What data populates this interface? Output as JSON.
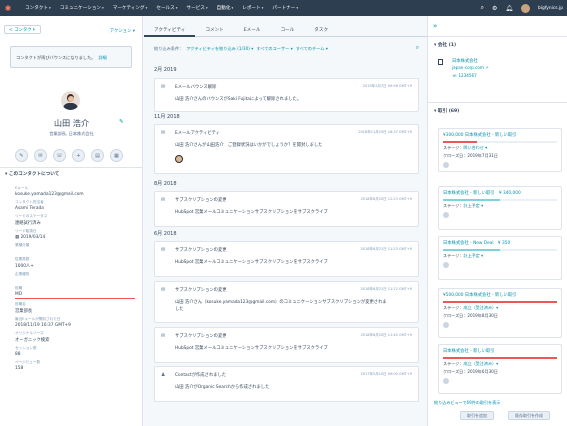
{
  "topnav": {
    "items": [
      "コンタクト",
      "コミュニケーション",
      "マーケティング",
      "セールス",
      "サービス",
      "自動化",
      "レポート",
      "パートナー"
    ],
    "account": "bigfynics.jp"
  },
  "left": {
    "back_button": "< コンタクト",
    "action_link": "アクション ▾",
    "bounce_notice": "コンタクトが再びバウンスになりました。",
    "bounce_link": "詳細",
    "name": "山田 浩介",
    "subtitle": "営業部長, 日本株式会社",
    "section_title": "このコンタクトについて",
    "properties": [
      {
        "label": "Eメール",
        "value": "kosuke.yamada123@gmail.com"
      },
      {
        "label": "コンタクト担当者",
        "value": "Asami Terada"
      },
      {
        "label": "リードのステータス",
        "value": "連絡試行済み"
      },
      {
        "label": "リード転換日",
        "value": "2019/03/14"
      },
      {
        "label": "業種分類",
        "value": ""
      },
      {
        "label": "従業員数",
        "value": "1000人+"
      },
      {
        "label": "企業種別",
        "value": ""
      },
      {
        "label": "役職",
        "value": "MD"
      },
      {
        "label": "役職名",
        "value": "営業部長"
      },
      {
        "label": "最近Eメールが開封された日",
        "value": "2018/11/19 16:37 GMT+9"
      },
      {
        "label": "オリジナルソース",
        "value": "オーガニック検索"
      },
      {
        "label": "セッション数",
        "value": "88"
      },
      {
        "label": "ページビュー数",
        "value": "158"
      }
    ]
  },
  "middle": {
    "tabs": [
      "アクティビティ",
      "コメント",
      "Eメール",
      "コール",
      "タスク"
    ],
    "filter_label": "絞り込み条件：",
    "filter_activity": "アクティビティを絞り込み (1/30) ▾",
    "filter_users": "すべてのユーザー ▾",
    "filter_teams": "すべてのチーム ▾",
    "months": [
      "2月 2019",
      "11月 2018",
      "8月 2018",
      "6月 2018"
    ],
    "cards": [
      {
        "title": "Eメールバウンス解除",
        "time": "2019年2月7日 09:58 GMT+9",
        "body": "山田 浩介さんのバウンスがSaki Fujitaによって解除されました。"
      },
      {
        "title": "Eメールアクティビティ",
        "time": "2018年11月19日 16:37 GMT+9",
        "body": "山田 浩介さんが山田浩介　ご登録状況はいかがでしょうか？を開封しました"
      },
      {
        "title": "サブスクリプションの変更",
        "time": "2018年8月20日 12:23 GMT+9",
        "body": "HubSpot 営業メールコミュニケーションサブスクリプションをサブスクライブ"
      },
      {
        "title": "サブスクリプションの変更",
        "time": "2018年6月21日 11:23 GMT+9",
        "body": "HubSpot 営業メールコミュニケーションサブスクリプションをサブスクライブ"
      },
      {
        "title": "サブスクリプションの変更",
        "time": "2018年6月21日 11:22 GMT+9",
        "body": "山田 浩介さん（kosuke.yamada123@gmail.com）のコミュニケーションサブスクリプションが変更されました"
      },
      {
        "title": "サブスクリプションの変更",
        "time": "2018年6月20日 11:40 GMT+9",
        "body": "HubSpot 営業メールコミュニケーションサブスクリプションをサブスクライブ"
      },
      {
        "title": "Contactが作成されました",
        "time": "2017年5月10日 09:00 GMT+9",
        "body": "山田 浩介がOrganic Searchから作成されました"
      }
    ]
  },
  "right": {
    "company_section": "会社 (1)",
    "company": {
      "name": "日本株式会社",
      "domain": "japan-corp.com",
      "phone": "1234567"
    },
    "deals_section": "取引 (69)",
    "deals": [
      {
        "title": "¥300,000 日本株式会社 - 新しい取引",
        "stage_label": "ステージ：",
        "stage": "問い合わせ ▾",
        "close_label": "クローズ日：",
        "close": "2019年7月31日",
        "color": "#f2545b"
      },
      {
        "title": "日本株式会社 - 新しい取引　¥ 340,000",
        "stage_label": "ステージ：",
        "stage": "計上予定 ▾",
        "close_label": "",
        "close": "",
        "color": "#7fd1de"
      },
      {
        "title": "日本株式会社 - New Deal　¥ 350",
        "stage_label": "ステージ：",
        "stage": "計上予定 ▾",
        "close_label": "",
        "close": "",
        "color": "#7fd1de"
      },
      {
        "title": "¥500,000 日本株式会社 - 新しい取引",
        "stage_label": "ステージ：",
        "stage": "成立（受注済み）▾",
        "close_label": "クローズ日：",
        "close": "2019年8月30日",
        "color": "#f2545b"
      },
      {
        "title": "日本株式会社 - 新しい取引",
        "stage_label": "ステージ：",
        "stage": "成立（受注済み）▾",
        "close_label": "クローズ日：",
        "close": "2019年6月30日",
        "color": "#f2545b"
      }
    ],
    "view_all": "絞り込みビューで69件の取引を表示",
    "add_button": "取引を追加",
    "create_button": "既存取引を作成"
  }
}
